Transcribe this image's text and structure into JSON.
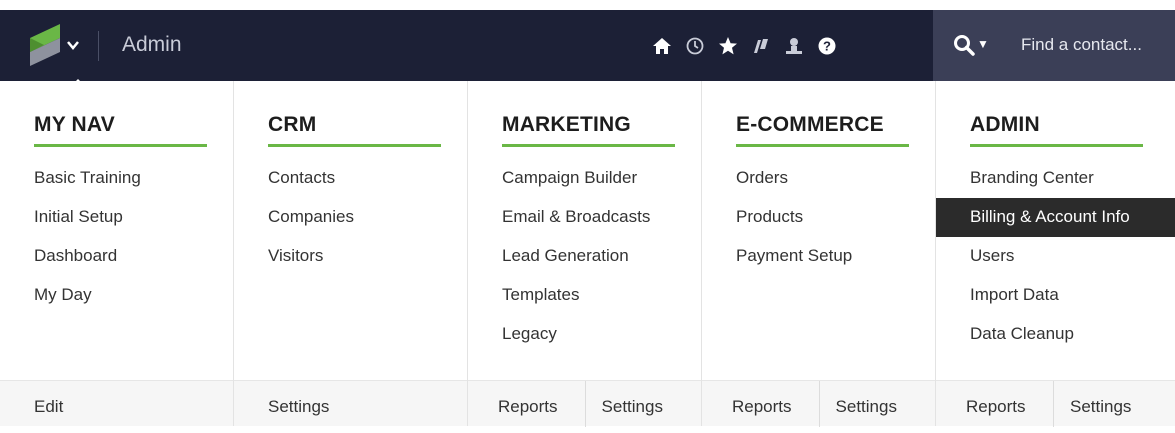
{
  "header": {
    "app_title": "Admin",
    "icons": [
      "home-icon",
      "clock-icon",
      "star-icon",
      "flag-icon",
      "person-icon",
      "help-icon"
    ],
    "search": {
      "placeholder": "Find a contact..."
    },
    "colors": {
      "bar": "#1c2036",
      "search_bg": "#3b3f57",
      "accent": "#6ab746"
    }
  },
  "columns": [
    {
      "title": "MY NAV",
      "items": [
        "Basic Training",
        "Initial Setup",
        "Dashboard",
        "My Day"
      ],
      "footer": [
        "Edit"
      ]
    },
    {
      "title": "CRM",
      "items": [
        "Contacts",
        "Companies",
        "Visitors"
      ],
      "footer": [
        "Settings"
      ]
    },
    {
      "title": "MARKETING",
      "items": [
        "Campaign Builder",
        "Email & Broadcasts",
        "Lead Generation",
        "Templates",
        "Legacy"
      ],
      "footer": [
        "Reports",
        "Settings"
      ]
    },
    {
      "title": "E-COMMERCE",
      "items": [
        "Orders",
        "Products",
        "Payment Setup"
      ],
      "footer": [
        "Reports",
        "Settings"
      ]
    },
    {
      "title": "ADMIN",
      "items": [
        "Branding Center",
        "Billing & Account Info",
        "Users",
        "Import Data",
        "Data Cleanup"
      ],
      "active_item": "Billing & Account Info",
      "footer": [
        "Reports",
        "Settings"
      ]
    }
  ]
}
